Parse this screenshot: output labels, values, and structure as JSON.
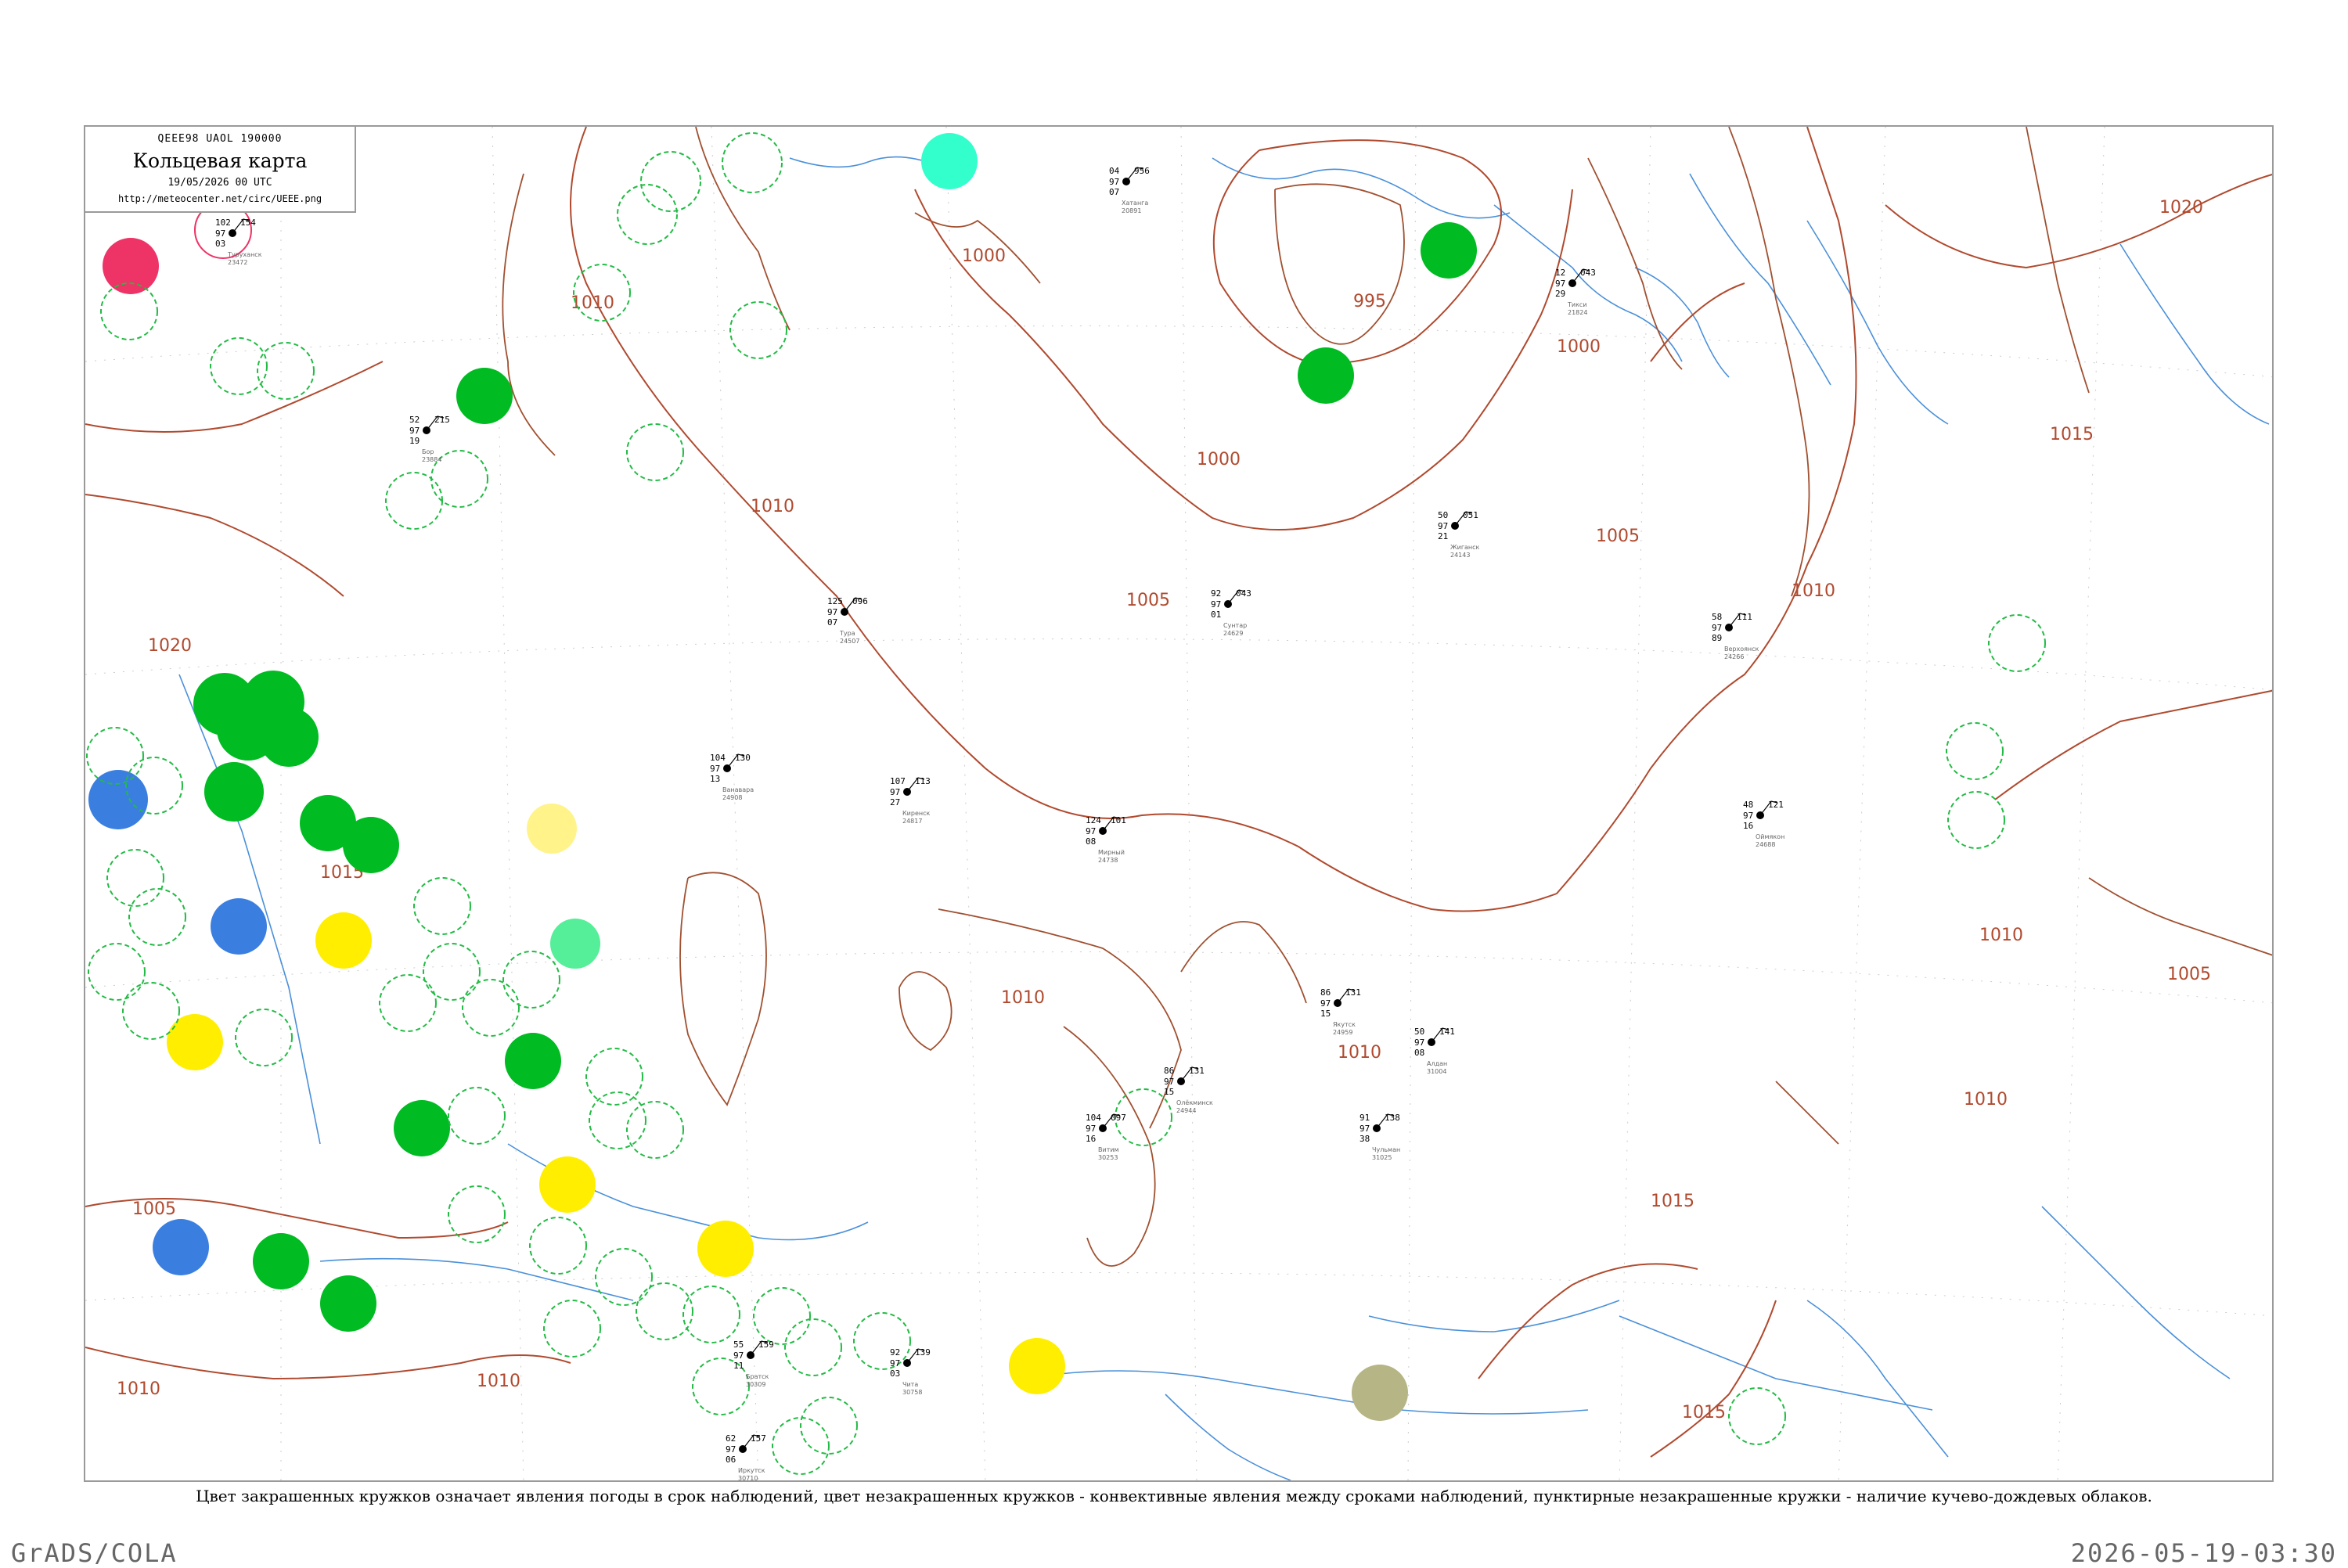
{
  "header": {
    "code": "QEEE98  UAOL  190000",
    "title": "Кольцевая карта",
    "datetime": "19/05/2026 00 UTC",
    "url": "http://meteocenter.net/circ/UEEE.png"
  },
  "caption": "Цвет закрашенных кружков означает явления погоды в срок наблюдений, цвет незакрашенных кружков - конвективные явления между сроками наблюдений, пунктирные незакрашенные кружки - наличие кучево-дождевых облаков.",
  "footer": {
    "left": "GrADS/COLA",
    "right": "2026-05-19-03:30"
  },
  "colors": {
    "isobar": "#b04a2f",
    "rivers": "#4a90d9",
    "green_fill": "#00bb22",
    "green_dashed": "#22bb44",
    "yellow": "#ffee00",
    "pale_yellow": "#fff38a",
    "blue": "#3a7fe0",
    "red": "#ee3366",
    "cyan": "#33ffcc",
    "mint": "#55ee99",
    "olive": "#b6b585",
    "frame": "#9a9a9a"
  },
  "isobar_labels": [
    "1000",
    "1005",
    "1010",
    "1015",
    "1020"
  ],
  "stations": [
    {
      "name": "Туруханск",
      "index": "23472",
      "a": "102",
      "b": "154",
      "c": "97",
      "d": "03"
    },
    {
      "name": "Бор",
      "index": "23884",
      "a": "52",
      "b": "215",
      "c": "97",
      "d": "19"
    },
    {
      "name": "Ванавара",
      "index": "24908",
      "a": "104",
      "b": "130",
      "c": "97",
      "d": "13"
    },
    {
      "name": "Тура",
      "index": "24507",
      "a": "125",
      "b": "096",
      "c": "97",
      "d": "07"
    },
    {
      "name": "Чульман",
      "index": "31025",
      "a": "91",
      "b": "138",
      "c": "97",
      "d": "38"
    },
    {
      "name": "Алдан",
      "index": "31004",
      "a": "50",
      "b": "141",
      "c": "97",
      "d": "08"
    },
    {
      "name": "Якутск",
      "index": "24959",
      "a": "86",
      "b": "131",
      "c": "97",
      "d": "15"
    },
    {
      "name": "Олёкминск",
      "index": "24944",
      "a": "86",
      "b": "131",
      "c": "97",
      "d": "15"
    },
    {
      "name": "Верхоянск",
      "index": "24266",
      "a": "58",
      "b": "111",
      "c": "97",
      "d": "89"
    },
    {
      "name": "Жиганск",
      "index": "24143",
      "a": "50",
      "b": "051",
      "c": "97",
      "d": "21"
    },
    {
      "name": "Оймякон",
      "index": "24688",
      "a": "48",
      "b": "121",
      "c": "97",
      "d": "16"
    },
    {
      "name": "Витим",
      "index": "30253",
      "a": "104",
      "b": "097",
      "c": "97",
      "d": "16"
    },
    {
      "name": "Киренск",
      "index": "24817",
      "a": "107",
      "b": "113",
      "c": "97",
      "d": "27"
    },
    {
      "name": "Братск",
      "index": "30309",
      "a": "55",
      "b": "159",
      "c": "97",
      "d": "11"
    },
    {
      "name": "Иркутск",
      "index": "30710",
      "a": "62",
      "b": "157",
      "c": "97",
      "d": "06"
    },
    {
      "name": "Чита",
      "index": "30758",
      "a": "92",
      "b": "139",
      "c": "97",
      "d": "03"
    },
    {
      "name": "Хатанга",
      "index": "20891",
      "a": "04",
      "b": "956",
      "c": "97",
      "d": "07"
    },
    {
      "name": "Тикси",
      "index": "21824",
      "a": "12",
      "b": "043",
      "c": "97",
      "d": "29"
    },
    {
      "name": "Мирный",
      "index": "24738",
      "a": "124",
      "b": "101",
      "c": "97",
      "d": "08"
    },
    {
      "name": "Сунтар",
      "index": "24629",
      "a": "92",
      "b": "043",
      "c": "97",
      "d": "01"
    }
  ]
}
